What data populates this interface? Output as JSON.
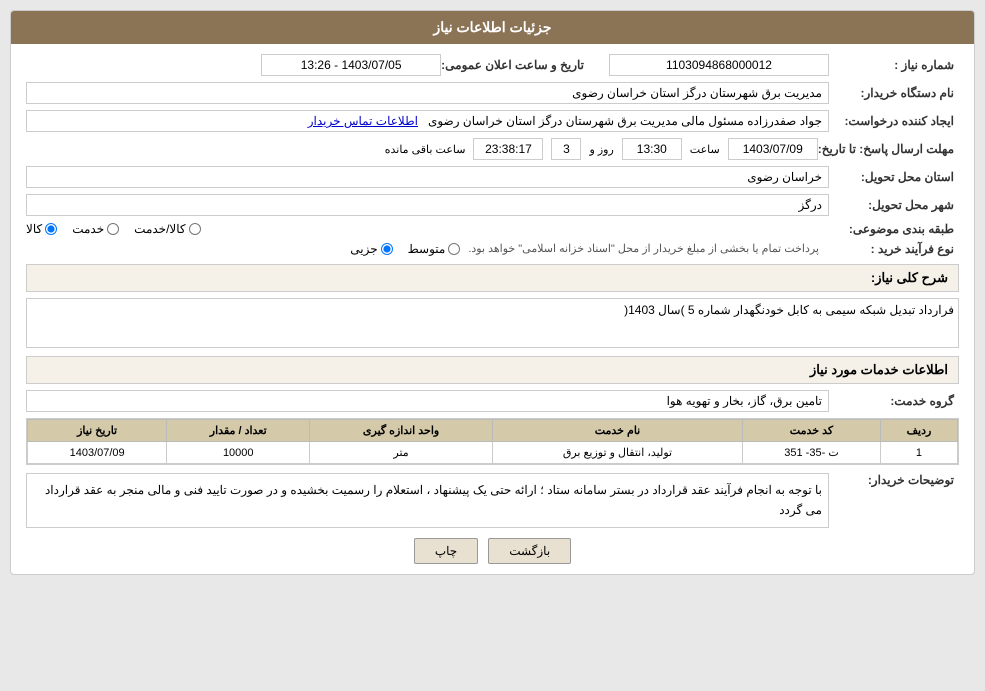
{
  "page": {
    "header": "جزئیات اطلاعات نیاز",
    "sections": {
      "main_info": "اطلاعات خدمات مورد نیاز"
    }
  },
  "fields": {
    "shomara_niaz_label": "شماره نیاز :",
    "shomara_niaz_value": "1103094868000012",
    "date_announce_label": "تاریخ و ساعت اعلان عمومی:",
    "date_announce_value": "1403/07/05 - 13:26",
    "name_destgah_label": "نام دستگاه خریدار:",
    "name_destgah_value": "مدیریت برق شهرستان درگز استان خراسان رضوی",
    "creator_label": "ایجاد کننده درخواست:",
    "creator_value": "جواد صفدرزاده مسئول مالی  مدیریت برق شهرستان درگز استان خراسان رضوی",
    "contact_link": "اطلاعات تماس خریدار",
    "deadline_label": "مهلت ارسال پاسخ: تا تاریخ:",
    "deadline_date": "1403/07/09",
    "deadline_time_label": "ساعت",
    "deadline_time": "13:30",
    "deadline_day_label": "روز و",
    "deadline_days": "3",
    "deadline_remaining_label": "ساعت باقی مانده",
    "deadline_remaining": "23:38:17",
    "province_label": "استان محل تحویل:",
    "province_value": "خراسان رضوی",
    "city_label": "شهر محل تحویل:",
    "city_value": "درگز",
    "category_label": "طبقه بندی موضوعی:",
    "category_kala": "کالا",
    "category_khadamat": "خدمت",
    "category_kala_khadamat": "کالا/خدمت",
    "process_label": "نوع فرآیند خرید :",
    "process_jazyi": "جزیی",
    "process_motavaser": "متوسط",
    "process_desc": "پرداخت تمام یا بخشی از مبلغ خریدار از محل \"اسناد خزانه اسلامی\" خواهد بود.",
    "description_label": "شرح کلی نیاز:",
    "description_value": "فرارداد تبدیل شبکه سیمی به کابل خودنگهدار شماره 5 )سال 1403(",
    "services_label": "اطلاعات خدمات مورد نیاز",
    "service_group_label": "گروه خدمت:",
    "service_group_value": "تامین برق، گاز، بخار و تهویه هوا",
    "table": {
      "headers": [
        "ردیف",
        "کد خدمت",
        "نام خدمت",
        "واحد اندازه گیری",
        "تعداد / مقدار",
        "تاریخ نیاز"
      ],
      "rows": [
        {
          "row": "1",
          "code": "ت -35- 351",
          "name": "تولید، انتقال و توزیع برق",
          "unit": "متر",
          "quantity": "10000",
          "date": "1403/07/09"
        }
      ]
    },
    "buyer_notes_label": "توضیحات خریدار:",
    "buyer_notes_value": "با توجه به انجام فرآیند عقد قرارداد در بستر سامانه ستاد ؛ ارائه حتی یک پیشنهاد ، استعلام را رسمیت بخشیده و در صورت تایید فنی و مالی منجر به عقد قرارداد می گردد"
  },
  "buttons": {
    "print": "چاپ",
    "back": "بازگشت"
  }
}
